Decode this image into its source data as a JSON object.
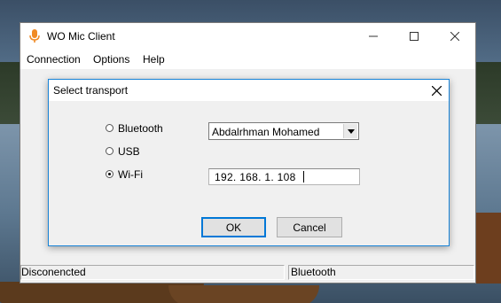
{
  "main_window": {
    "title": "WO Mic Client",
    "menu": [
      "Connection",
      "Options",
      "Help"
    ],
    "status": {
      "connection": "Disconencted",
      "transport": "Bluetooth"
    }
  },
  "dialog": {
    "title": "Select transport",
    "options": [
      {
        "label": "Bluetooth",
        "selected": false
      },
      {
        "label": "USB",
        "selected": false
      },
      {
        "label": "Wi-Fi",
        "selected": true
      }
    ],
    "bluetooth_device": "Abdalrhman Mohamed",
    "ip_address": "192. 168. 1. 108",
    "ok_label": "OK",
    "cancel_label": "Cancel"
  },
  "colors": {
    "accent": "#0078d7",
    "mic_icon": "#f08a24"
  },
  "icons": [
    "microphone-icon",
    "minimize-icon",
    "maximize-icon",
    "close-icon",
    "dropdown-arrow-icon"
  ]
}
